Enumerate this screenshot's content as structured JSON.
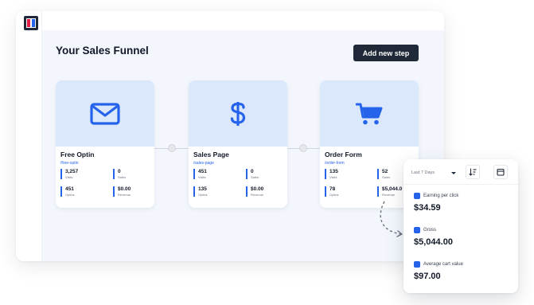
{
  "header": {
    "title": "Your Sales Funnel",
    "add_step_label": "Add new step"
  },
  "steps": [
    {
      "name": "Free Optin",
      "path": "/free-optin",
      "icon": "mail-icon",
      "stats": [
        {
          "value": "3,257",
          "label": "Visits"
        },
        {
          "value": "0",
          "label": "Sales"
        },
        {
          "value": "451",
          "label": "Optins"
        },
        {
          "value": "$0.00",
          "label": "Revenue"
        }
      ]
    },
    {
      "name": "Sales Page",
      "path": "/sales-page",
      "icon": "dollar-icon",
      "stats": [
        {
          "value": "451",
          "label": "Visits"
        },
        {
          "value": "0",
          "label": "Sales"
        },
        {
          "value": "135",
          "label": "Optins"
        },
        {
          "value": "$0.00",
          "label": "Revenue"
        }
      ]
    },
    {
      "name": "Order Form",
      "path": "/order-form",
      "icon": "cart-icon",
      "stats": [
        {
          "value": "135",
          "label": "Visits"
        },
        {
          "value": "52",
          "label": "Sales"
        },
        {
          "value": "78",
          "label": "Optins"
        },
        {
          "value": "$5,044.0",
          "label": "Revenue"
        }
      ]
    }
  ],
  "stats_panel": {
    "date_range": "Last 7 Days",
    "metrics": [
      {
        "label": "Earning per click",
        "value": "$34.59"
      },
      {
        "label": "Gross",
        "value": "$5,044.00"
      },
      {
        "label": "Average cart value",
        "value": "$97.00"
      }
    ]
  },
  "colors": {
    "accent": "#2563eb",
    "dark": "#1f2937",
    "thumb_bg": "#dbe7fb",
    "canvas_bg": "#f3f7fd"
  }
}
